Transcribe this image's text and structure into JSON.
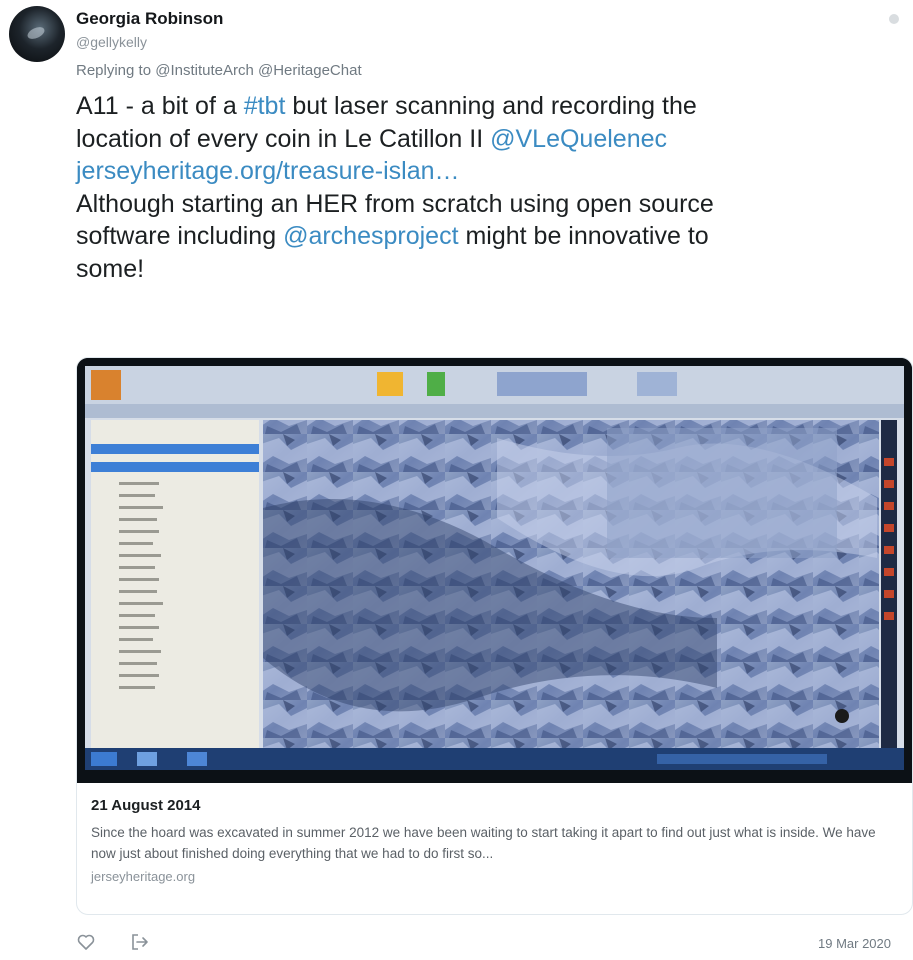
{
  "author": {
    "name": "Georgia Robinson",
    "handle": "@gellykelly"
  },
  "replying": {
    "prefix": "Replying to",
    "mentions": [
      "@InstituteArch",
      "@HeritageChat"
    ]
  },
  "tweet": {
    "line1_a": "A11 - a bit of a ",
    "line1_hashtag": "#tbt",
    "line1_b": " but laser scanning and recording the",
    "line2_a": "location of every coin in Le Catillon II ",
    "line2_mention": "@VLeQuelenec",
    "line3_link": "jerseyheritage.org/treasure-islan…",
    "line4": "Although starting an HER from scratch using open source",
    "line5_a": "software including ",
    "line5_mention": "@archesproject",
    "line5_b": " might be innovative to",
    "line6": "some!"
  },
  "card": {
    "image_desc": "photo of a computer monitor showing laser scan software",
    "title": "21 August 2014",
    "description": "Since the hoard was excavated in summer 2012 we have been waiting to start taking it apart to find out just what is inside. We have now just about finished doing everything that we had to do first so...",
    "domain": "jerseyheritage.org"
  },
  "actions": {
    "like_icon": "heart-icon",
    "share_icon": "share-icon"
  },
  "timestamp": "19 Mar 2020",
  "colors": {
    "link": "#3b8bc2",
    "text": "#1c2022",
    "muted": "#8a9299"
  }
}
